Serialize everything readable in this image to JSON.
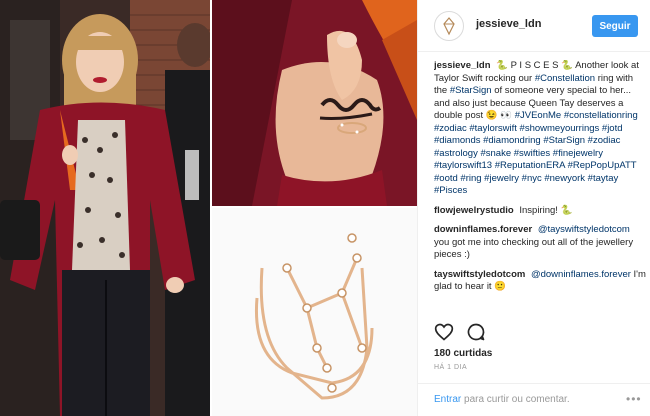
{
  "post": {
    "username": "jessieve_ldn",
    "follow_label": "Seguir",
    "caption_user": "jessieve_ldn",
    "caption_parts": [
      {
        "t": "🐍 P I S C E S 🐍 Another look at Taylor Swift rocking our ",
        "tag": false
      },
      {
        "t": "#Constellation",
        "tag": true
      },
      {
        "t": " ring with the ",
        "tag": false
      },
      {
        "t": "#StarSign",
        "tag": true
      },
      {
        "t": " of someone very special to her... and also just because Queen Tay deserves a double post 😉 👀 ",
        "tag": false
      },
      {
        "t": "#JVEonMe #constellationring #zodiac #taylorswift #showmeyourrings #jotd #diamonds #diamondring #StarSign #zodiac #astrology #snake #swifties #finejewelry #taylorswift13 #ReputationERA #RepPopUpATT #ootd #ring #jewelry #nyc #newyork #taytay #Pisces",
        "tag": true
      }
    ],
    "comments": [
      {
        "user": "flowjewelrystudio",
        "text": "Inspiring! 🐍",
        "mention": "",
        "after": ""
      },
      {
        "user": "downinflames.forever",
        "text": "",
        "mention": "@tayswiftstyledotcom",
        "after": " you got me into checking out all of the jewellery pieces :)"
      },
      {
        "user": "tayswiftstyledotcom",
        "text": "",
        "mention": "@downinflames.forever",
        "after": " I'm glad to hear it 🙂"
      }
    ],
    "likes": "180 curtidas",
    "timestamp": "HÁ 1 DIA",
    "add_comment": {
      "link": "Entrar",
      "rest": " para curtir ou comentar."
    },
    "more_icon": "ellipsis-icon"
  },
  "colors": {
    "accent": "#3897f0",
    "hashtag": "#003569"
  },
  "icons": [
    "heart-icon",
    "comment-icon",
    "diamond-logo-icon",
    "ellipsis-icon"
  ]
}
